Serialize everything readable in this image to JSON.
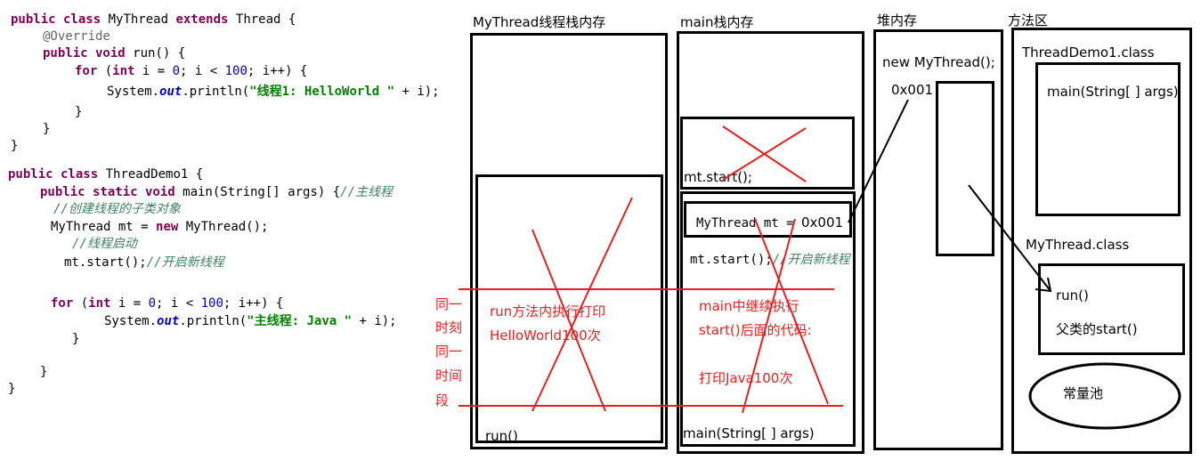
{
  "code": {
    "l1_kw1": "public class",
    "l1_name": " MyThread ",
    "l1_kw2": "extends",
    "l1_rest": " Thread {",
    "l2": "@Override",
    "l3_kw": "public void",
    "l3_rest": " run() {",
    "l4_kw": "for",
    "l4_a": " (",
    "l4_kw2": "int",
    "l4_b": " i = ",
    "l4_n1": "0",
    "l4_c": "; i < ",
    "l4_n2": "100",
    "l4_d": "; i++) {",
    "l5_a": "System.",
    "l5_out": "out",
    "l5_b": ".println(",
    "l5_str": "\"线程1: HelloWorld \"",
    "l5_c": " + i);",
    "l6": "}",
    "l7": "}",
    "l8": "}",
    "l9_kw": "public class",
    "l9_rest": " ThreadDemo1 {",
    "l10_kw": "public static void",
    "l10_rest": " main(String[] args) {",
    "l10_cmt": "//主线程",
    "l11_cmt": "//创建线程的子类对象",
    "l12_a": "MyThread mt = ",
    "l12_kw": "new",
    "l12_b": " MyThread();",
    "l13_cmt": "//线程启动",
    "l14_a": "mt.start();",
    "l14_cmt": "//开启新线程",
    "l15_kw": "for",
    "l15_a": " (",
    "l15_kw2": "int",
    "l15_b": " i = ",
    "l15_n1": "0",
    "l15_c": "; i < ",
    "l15_n2": "100",
    "l15_d": "; i++) {",
    "l16_a": "System.",
    "l16_out": "out",
    "l16_b": ".println(",
    "l16_str": "\"主线程: Java \"",
    "l16_c": " + i);",
    "l17": "}",
    "l18": "}",
    "l19": "}"
  },
  "diagram": {
    "mythread_stack_title": "MyThread线程栈内存",
    "main_stack_title": "main栈内存",
    "heap_title": "堆内存",
    "method_area_title": "方法区",
    "run_frame_label": "run()",
    "run_desc_1": "run方法内执行打印",
    "run_desc_2": "HelloWorld100次",
    "start_frame_label": "mt.start();",
    "main_var_decl": "MyThread mt = ",
    "main_var_addr": "0x001",
    "main_start_line_code": "mt.start();",
    "main_start_line_cmt": "//开启新线程",
    "main_desc_1": "main中继续执行",
    "main_desc_2": "start()后面的代码:",
    "main_desc_3": "打印Java100次",
    "main_frame_label": "main(String[ ] args)",
    "heap_new": "new MyThread();",
    "heap_addr": "0x001",
    "threaddemo_class": "ThreadDemo1.class",
    "main_method": "main(String[ ] args)",
    "mythread_class": "MyThread.class",
    "run_method": "run()",
    "parent_start": "父类的start()",
    "constant_pool": "常量池",
    "side_note": [
      "同一",
      "时刻",
      "同一",
      "时间",
      "段"
    ]
  }
}
